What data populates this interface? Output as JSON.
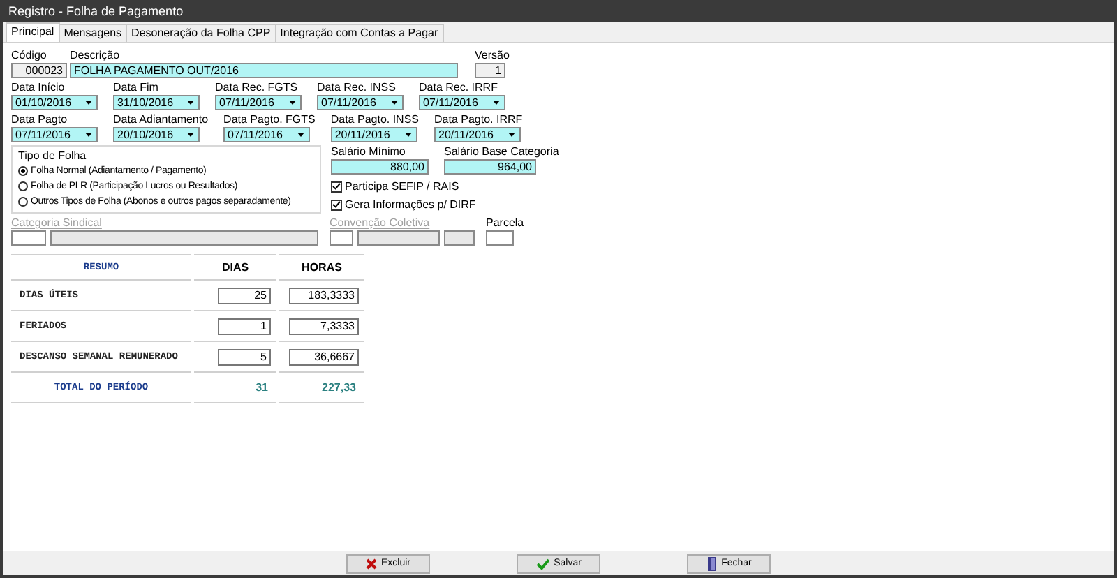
{
  "window": {
    "title": "Registro - Folha de Pagamento"
  },
  "tabs": [
    {
      "label": "Principal",
      "selected": true
    },
    {
      "label": "Mensagens",
      "selected": false
    },
    {
      "label": "Desoneração da Folha CPP",
      "selected": false
    },
    {
      "label": "Integração com Contas a Pagar",
      "selected": false
    }
  ],
  "codigo": {
    "label": "Código",
    "value": "000023"
  },
  "descricao": {
    "label": "Descrição",
    "value": "FOLHA PAGAMENTO OUT/2016"
  },
  "versao": {
    "label": "Versão",
    "value": "1"
  },
  "dates": [
    {
      "label": "Data Início",
      "value": "01/10/2016"
    },
    {
      "label": "Data Fim",
      "value": "31/10/2016"
    },
    {
      "label": "Data Rec. FGTS",
      "value": "07/11/2016"
    },
    {
      "label": "Data Rec. INSS",
      "value": "07/11/2016"
    },
    {
      "label": "Data Rec. IRRF",
      "value": "07/11/2016"
    },
    {
      "label": "Data Pagto",
      "value": "07/11/2016"
    },
    {
      "label": "Data Adiantamento",
      "value": "20/10/2016"
    },
    {
      "label": "Data Pagto. FGTS",
      "value": "07/11/2016"
    },
    {
      "label": "Data Pagto. INSS",
      "value": "20/11/2016"
    },
    {
      "label": "Data Pagto. IRRF",
      "value": "20/11/2016"
    }
  ],
  "tipo_de_folha": {
    "title": "Tipo de Folha",
    "options": [
      {
        "label": "Folha Normal (Adiantamento / Pagamento)",
        "selected": true
      },
      {
        "label": "Folha de PLR (Participação Lucros ou Resultados)",
        "selected": false
      },
      {
        "label": "Outros Tipos de Folha (Abonos e outros pagos separadamente)",
        "selected": false
      }
    ]
  },
  "salarios": [
    {
      "label": "Salário Mínimo",
      "value": "880,00"
    },
    {
      "label": "Salário Base Categoria",
      "value": "964,00"
    }
  ],
  "checkboxes": [
    {
      "label": "Participa SEFIP / RAIS",
      "checked": true
    },
    {
      "label": "Gera Informações p/ DIRF",
      "checked": true
    }
  ],
  "categoria_sindical": {
    "label": "Categoria Sindical",
    "disabled": true
  },
  "convencao_coletiva": {
    "label": "Convenção Coletiva",
    "disabled": true
  },
  "parcela": {
    "label": "Parcela"
  },
  "resumo": {
    "columns": [
      "RESUMO",
      "DIAS",
      "HORAS"
    ],
    "rows": [
      {
        "label": "DIAS ÚTEIS",
        "dias": "25",
        "horas": "183,3333"
      },
      {
        "label": "FERIADOS",
        "dias": "1",
        "horas": "7,3333"
      },
      {
        "label": "DESCANSO SEMANAL REMUNERADO",
        "dias": "5",
        "horas": "36,6667"
      }
    ],
    "total": {
      "label": "TOTAL DO PERÍODO",
      "dias": "31",
      "horas": "227,33"
    }
  },
  "buttons": [
    {
      "label": "Excluir",
      "kind": "delete"
    },
    {
      "label": "Salvar",
      "kind": "save"
    },
    {
      "label": "Fechar",
      "kind": "close"
    }
  ]
}
